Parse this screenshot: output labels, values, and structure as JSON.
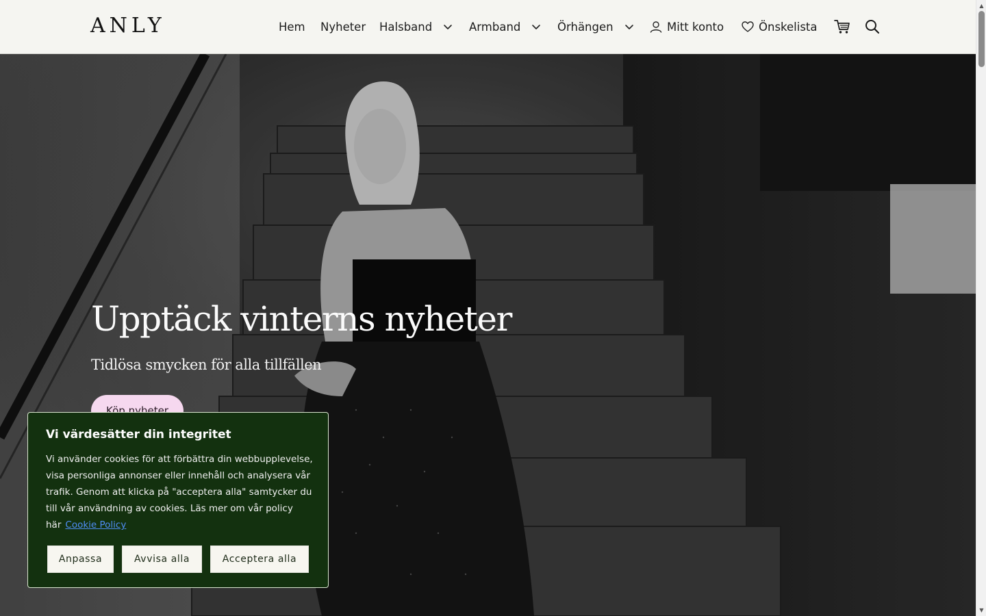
{
  "brand": {
    "logo": "ANLY"
  },
  "nav": {
    "items": [
      {
        "label": "Hem"
      },
      {
        "label": "Nyheter"
      },
      {
        "label": "Halsband"
      },
      {
        "label": "Armband"
      },
      {
        "label": "Örhängen"
      },
      {
        "label": "Mitt konto"
      },
      {
        "label": "Önskelista"
      }
    ],
    "icons": {
      "account": "user-icon",
      "wishlist": "heart-icon",
      "cart": "cart-icon",
      "search": "search-icon",
      "dropdown": "chevron-down-icon"
    }
  },
  "hero": {
    "title": "Upptäck vinterns nyheter",
    "subtitle": "Tidlösa smycken för alla tillfällen",
    "cta": "Köp nyheter"
  },
  "cookie": {
    "title": "Vi värdesätter din integritet",
    "body": "Vi använder cookies för att förbättra din webbupplevelse, visa personliga annonser eller innehåll och analysera vår trafik. Genom att klicka på \"acceptera alla\" samtycker du till vår användning av cookies. Läs mer om vår policy här",
    "link": "Cookie Policy",
    "buttons": {
      "customize": "Anpassa",
      "reject": "Avvisa alla",
      "accept": "Acceptera alla"
    }
  },
  "colors": {
    "header_bg": "#f5f5f1",
    "cookie_bg": "#13310f",
    "cta_bg": "#f6d8ef",
    "link": "#4f8ef7"
  }
}
